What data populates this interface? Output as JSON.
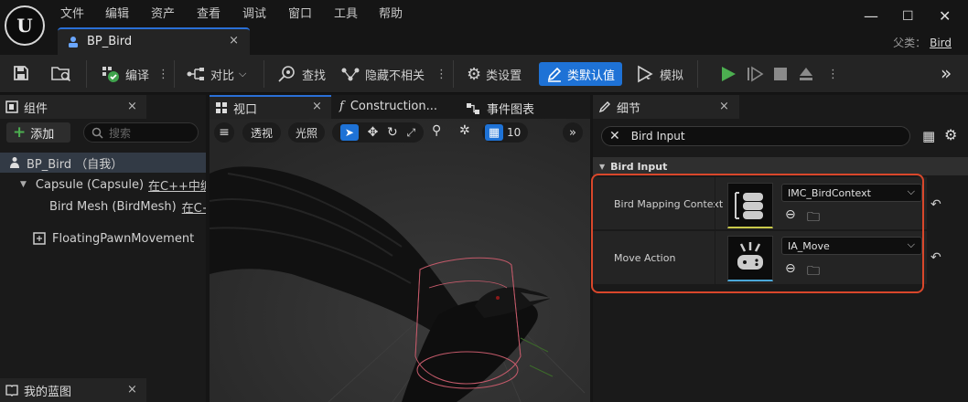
{
  "menu": [
    "文件",
    "编辑",
    "资产",
    "查看",
    "调试",
    "窗口",
    "工具",
    "帮助"
  ],
  "asset_tab": {
    "label": "BP_Bird",
    "close": "×"
  },
  "window_controls": {
    "minimize": "—",
    "maximize": "☐",
    "close": "✕"
  },
  "parent_class": {
    "label": "父类：",
    "value": "Bird"
  },
  "toolbar": {
    "compile": "编译",
    "diff": "对比",
    "find": "查找",
    "hide_unrelated": "隐藏不相关",
    "class_settings": "类设置",
    "class_defaults": "类默认值",
    "simulate": "模拟"
  },
  "components_panel": {
    "title": "组件",
    "add_button": "添加",
    "search_placeholder": "搜索",
    "tree": [
      {
        "label": "BP_Bird （自我）"
      },
      {
        "label": "Capsule (Capsule)",
        "note": "在C++中编"
      },
      {
        "label": "Bird Mesh (BirdMesh)",
        "note": "在C++"
      },
      {
        "label": "FloatingPawnMovement"
      }
    ],
    "my_blueprint": "我的蓝图"
  },
  "viewport_panel": {
    "tabs": [
      "视口",
      "Construction...",
      "事件图表"
    ],
    "view_mode": "透视",
    "lighting": "光照",
    "grid_size": "10"
  },
  "details_panel": {
    "title": "细节",
    "search_value": "Bird Input",
    "category": "Bird Input",
    "properties": [
      {
        "label": "Bird Mapping Context",
        "value": "IMC_BirdContext"
      },
      {
        "label": "Move Action",
        "value": "IA_Move"
      }
    ]
  },
  "colors": {
    "accent": "#1e72d6",
    "highlight_box": "#d9472b",
    "play": "#4caf50"
  }
}
